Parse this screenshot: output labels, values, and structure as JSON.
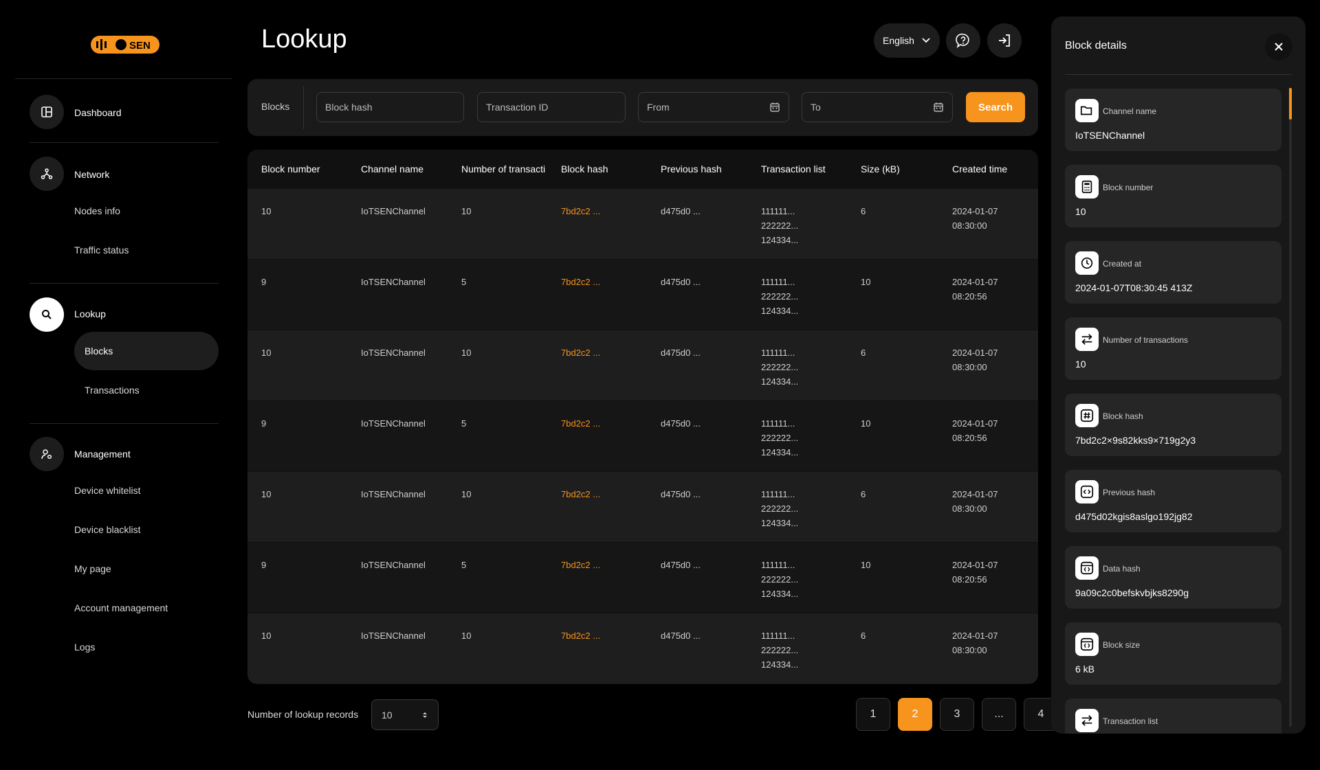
{
  "brand": {
    "logo_text": "IoTSEN",
    "accent": "#f7941d"
  },
  "sidebar": {
    "dashboard": "Dashboard",
    "network": "Network",
    "nodes_info": "Nodes info",
    "traffic_status": "Traffic status",
    "lookup": "Lookup",
    "blocks": "Blocks",
    "transactions": "Transactions",
    "management": "Management",
    "device_whitelist": "Device whitelist",
    "device_blacklist": "Device blacklist",
    "my_page": "My page",
    "account_management": "Account management",
    "logs": "Logs"
  },
  "header": {
    "title": "Lookup",
    "language": "English"
  },
  "filter": {
    "label": "Blocks",
    "block_hash_placeholder": "Block hash",
    "transaction_id_placeholder": "Transaction ID",
    "from_placeholder": "From",
    "to_placeholder": "To",
    "search_label": "Search"
  },
  "table": {
    "columns": [
      "Block number",
      "Channel name",
      "Number of transacti",
      "Block hash",
      "Previous hash",
      "Transaction list",
      "Size (kB)",
      "Created time"
    ],
    "rows": [
      {
        "block_number": "10",
        "channel": "IoTSENChannel",
        "tx_count": "10",
        "block_hash": "7bd2c2 ...",
        "prev_hash": "d475d0 ...",
        "tx1": "111111...",
        "tx2": "222222...",
        "tx3": "124334...",
        "size": "6",
        "date": "2024-01-07",
        "time": "08:30:00"
      },
      {
        "block_number": "9",
        "channel": "IoTSENChannel",
        "tx_count": "5",
        "block_hash": "7bd2c2 ...",
        "prev_hash": "d475d0 ...",
        "tx1": "111111...",
        "tx2": "222222...",
        "tx3": "124334...",
        "size": "10",
        "date": "2024-01-07",
        "time": "08:20:56"
      },
      {
        "block_number": "10",
        "channel": "IoTSENChannel",
        "tx_count": "10",
        "block_hash": "7bd2c2 ...",
        "prev_hash": "d475d0 ...",
        "tx1": "111111...",
        "tx2": "222222...",
        "tx3": "124334...",
        "size": "6",
        "date": "2024-01-07",
        "time": "08:30:00"
      },
      {
        "block_number": "9",
        "channel": "IoTSENChannel",
        "tx_count": "5",
        "block_hash": "7bd2c2 ...",
        "prev_hash": "d475d0 ...",
        "tx1": "111111...",
        "tx2": "222222...",
        "tx3": "124334...",
        "size": "10",
        "date": "2024-01-07",
        "time": "08:20:56"
      },
      {
        "block_number": "10",
        "channel": "IoTSENChannel",
        "tx_count": "10",
        "block_hash": "7bd2c2 ...",
        "prev_hash": "d475d0 ...",
        "tx1": "111111...",
        "tx2": "222222...",
        "tx3": "124334...",
        "size": "6",
        "date": "2024-01-07",
        "time": "08:30:00"
      },
      {
        "block_number": "9",
        "channel": "IoTSENChannel",
        "tx_count": "5",
        "block_hash": "7bd2c2 ...",
        "prev_hash": "d475d0 ...",
        "tx1": "111111...",
        "tx2": "222222...",
        "tx3": "124334...",
        "size": "10",
        "date": "2024-01-07",
        "time": "08:20:56"
      },
      {
        "block_number": "10",
        "channel": "IoTSENChannel",
        "tx_count": "10",
        "block_hash": "7bd2c2 ...",
        "prev_hash": "d475d0 ...",
        "tx1": "111111...",
        "tx2": "222222...",
        "tx3": "124334...",
        "size": "6",
        "date": "2024-01-07",
        "time": "08:30:00"
      }
    ]
  },
  "footer": {
    "records_label": "Number of lookup records",
    "records_value": "10",
    "pages": [
      "1",
      "2",
      "3",
      "...",
      "4"
    ],
    "active_page": "2"
  },
  "details": {
    "title": "Block details",
    "items": [
      {
        "label": "Channel name",
        "value": "IoTSENChannel",
        "icon": "folder-icon"
      },
      {
        "label": "Block number",
        "value": "10",
        "icon": "calculator-icon"
      },
      {
        "label": "Created at",
        "value": "2024-01-07T08:30:45 413Z",
        "icon": "clock-icon"
      },
      {
        "label": "Number of transactions",
        "value": "10",
        "icon": "transfer-icon"
      },
      {
        "label": "Block hash",
        "value": "7bd2c2×9s82kks9×719g2y3",
        "icon": "hash-icon"
      },
      {
        "label": "Previous hash",
        "value": "d475d02kgis8aslgo192jg82",
        "icon": "code-icon"
      },
      {
        "label": "Data hash",
        "value": "9a09c2c0befskvbjks8290g",
        "icon": "code-window-icon"
      },
      {
        "label": "Block size",
        "value": "6 kB",
        "icon": "code-window-icon"
      },
      {
        "label": "Transaction list",
        "value": "",
        "icon": "transfer-icon"
      }
    ]
  }
}
